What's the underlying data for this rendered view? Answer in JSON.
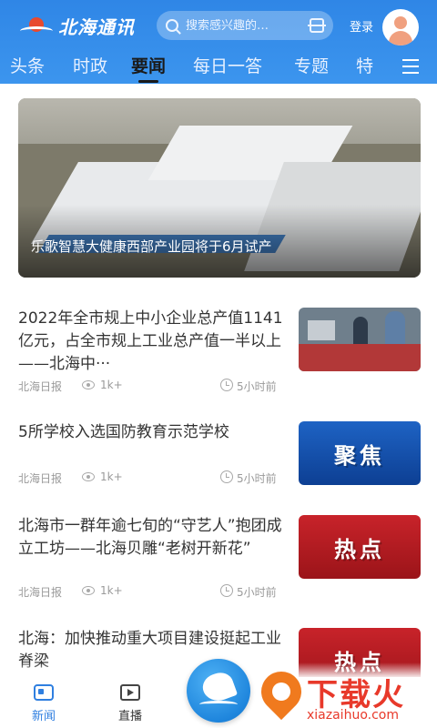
{
  "header": {
    "logo_text": "北海通讯",
    "search_placeholder": "搜索感兴趣的…",
    "login_label": "登录"
  },
  "tabs": [
    {
      "label": "头条"
    },
    {
      "label": "时政"
    },
    {
      "label": "要闻",
      "active": true
    },
    {
      "label": "每日一答"
    },
    {
      "label": "专题"
    },
    {
      "label": "特"
    }
  ],
  "hero": {
    "caption": "乐歌智慧大健康西部产业园将于6月试产"
  },
  "news": [
    {
      "title": "2022年全市规上中小企业总产值1141亿元，占全市规上工业总产值一半以上——北海中···",
      "source": "北海日报",
      "views": "1k+",
      "time": "5小时前",
      "thumb": "photo"
    },
    {
      "title": "5所学校入选国防教育示范学校",
      "source": "北海日报",
      "views": "1k+",
      "time": "5小时前",
      "thumb_text": "聚焦"
    },
    {
      "title": "北海市一群年逾七旬的“守艺人”抱团成立工坊——北海贝雕“老树开新花”",
      "source": "北海日报",
      "views": "1k+",
      "time": "5小时前",
      "thumb_text": "热点"
    },
    {
      "title": "北海：加快推动重大项目建设挺起工业脊梁",
      "thumb_text": "热点"
    }
  ],
  "bottom_nav": [
    {
      "label": "新闻",
      "active": true
    },
    {
      "label": "直播"
    }
  ],
  "watermark": {
    "big": "下载火",
    "small": "xiazaihuo.com"
  },
  "colors": {
    "header_blue": "#3c95ee",
    "active_nav": "#2f7fe0",
    "badge_blue": "#1e63c4",
    "badge_red": "#c8232a"
  }
}
